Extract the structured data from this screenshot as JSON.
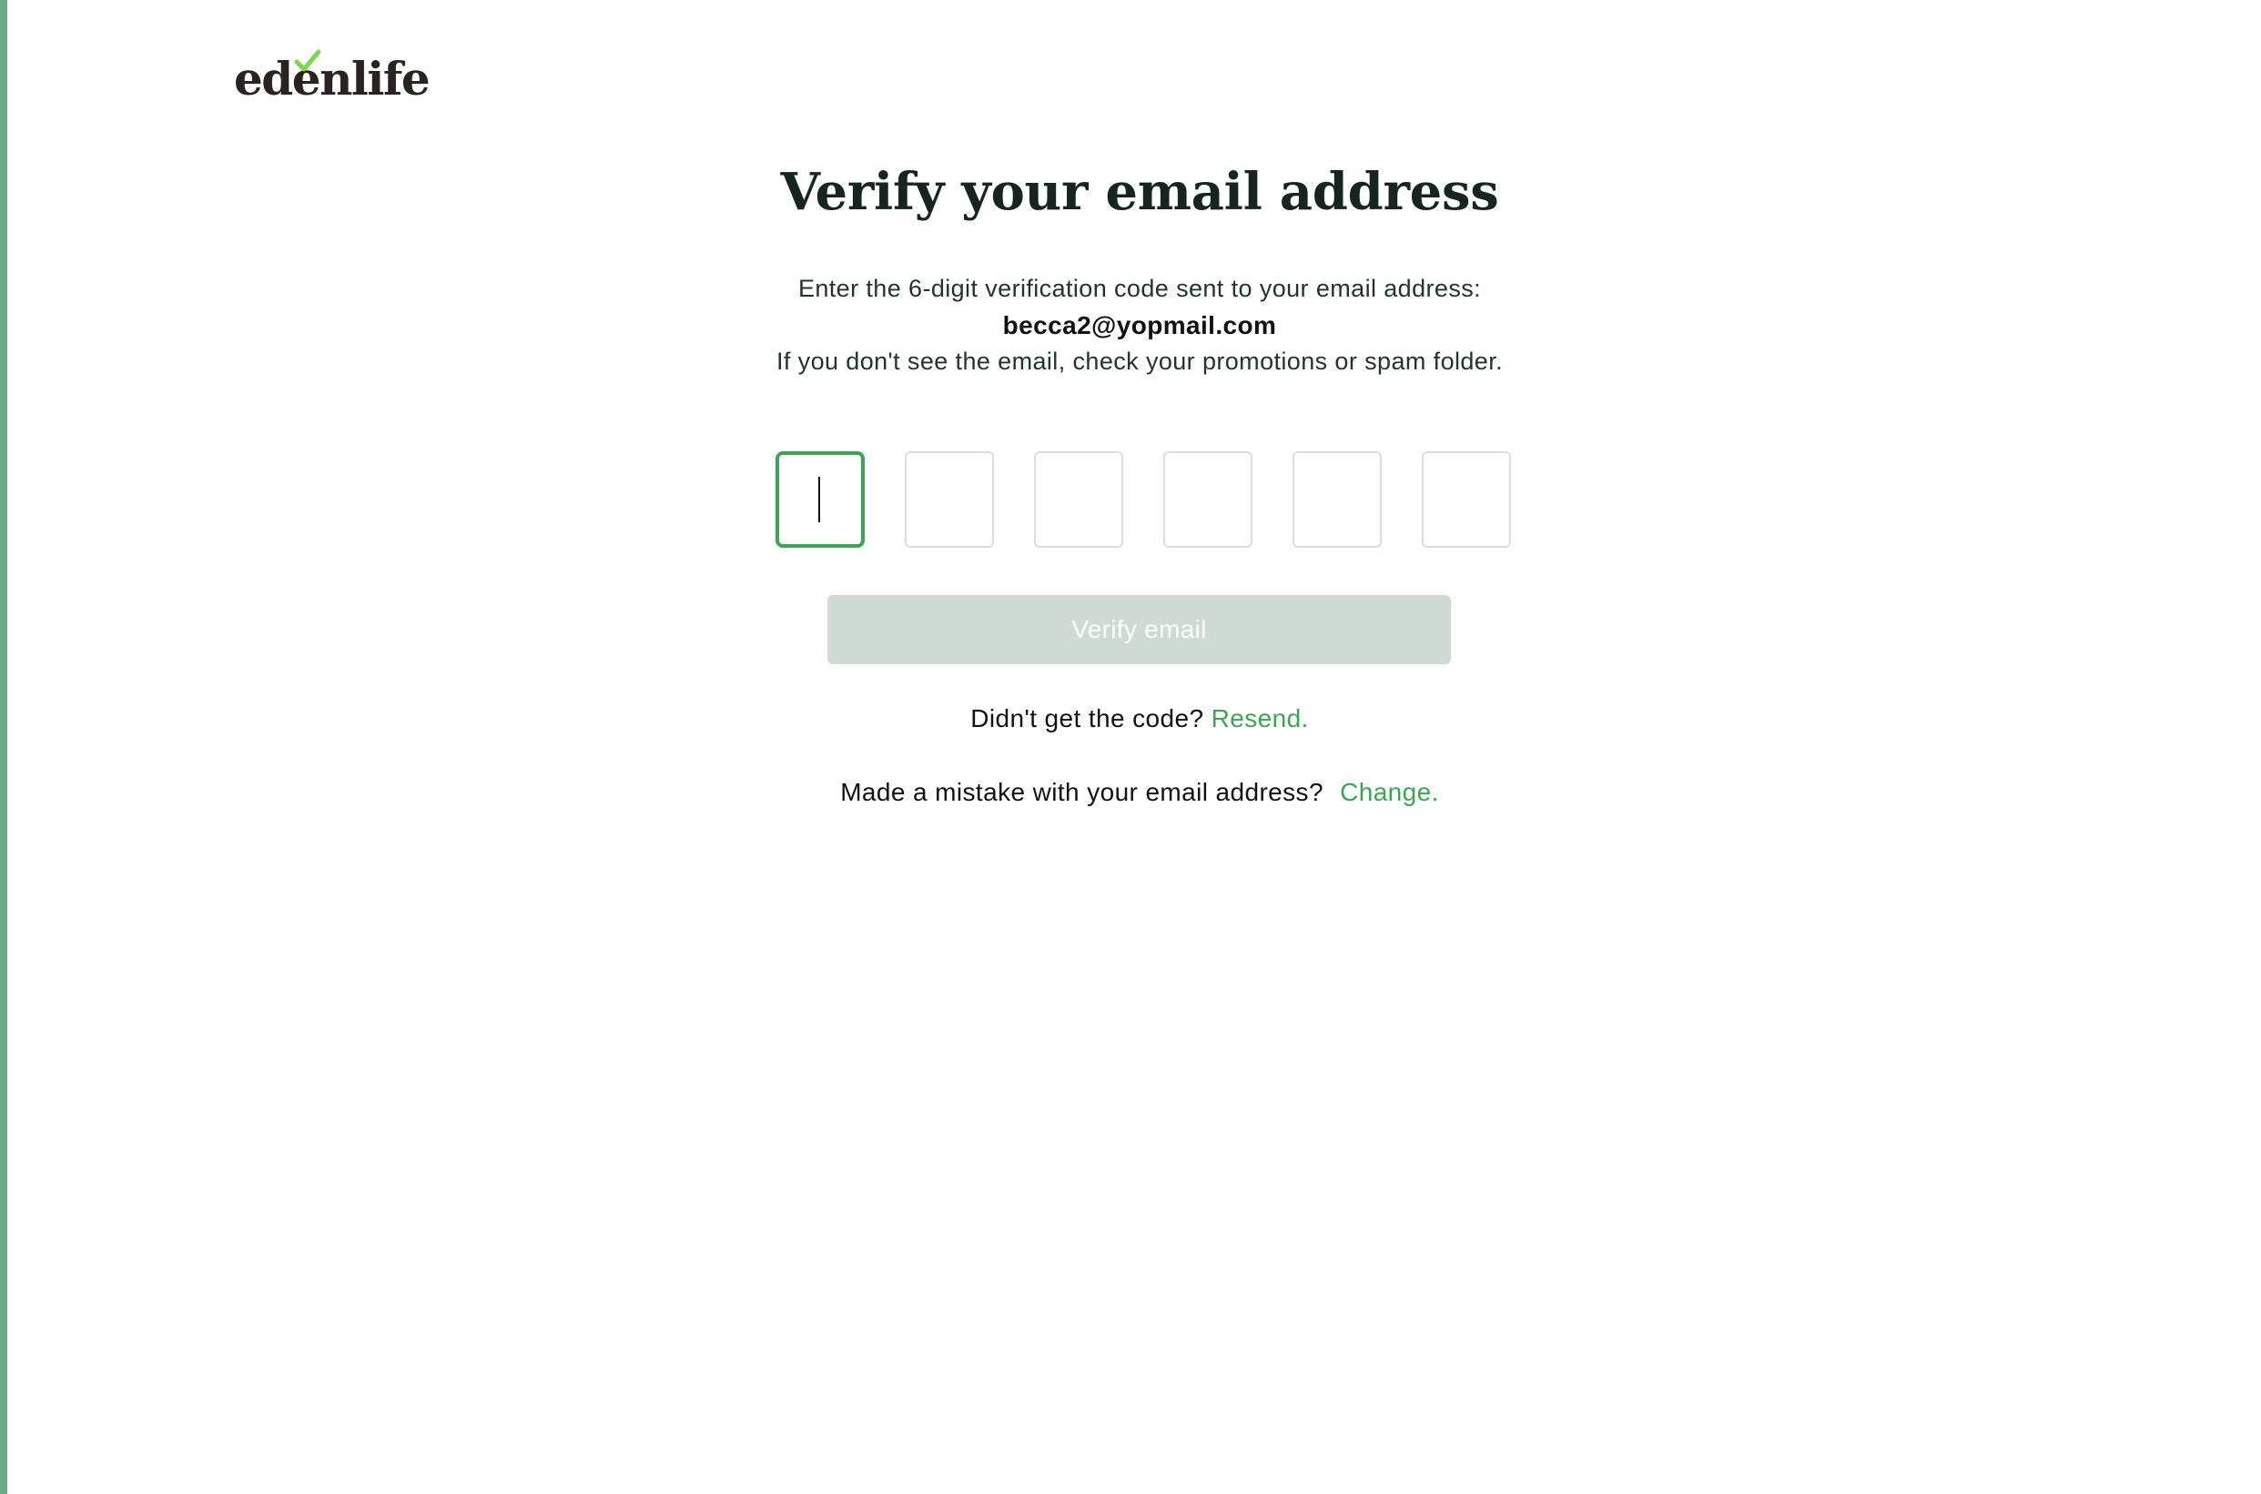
{
  "brand": {
    "logo_text": "edenlife",
    "accent_color": "#3fa356",
    "logo_check_color": "#7dd64f"
  },
  "verify": {
    "title": "Verify your email address",
    "instruction": "Enter the 6-digit verification code sent to your email address:",
    "email": "becca2@yopmail.com",
    "spam_hint": "If you don't see the email, check your promotions or spam folder.",
    "code_digits": [
      "",
      "",
      "",
      "",
      "",
      ""
    ],
    "button_label": "Verify email",
    "button_state": "disabled"
  },
  "resend": {
    "prompt": "Didn't get the code?",
    "link_label": "Resend."
  },
  "change": {
    "prompt": "Made a mistake with your email address?",
    "link_label": "Change."
  }
}
